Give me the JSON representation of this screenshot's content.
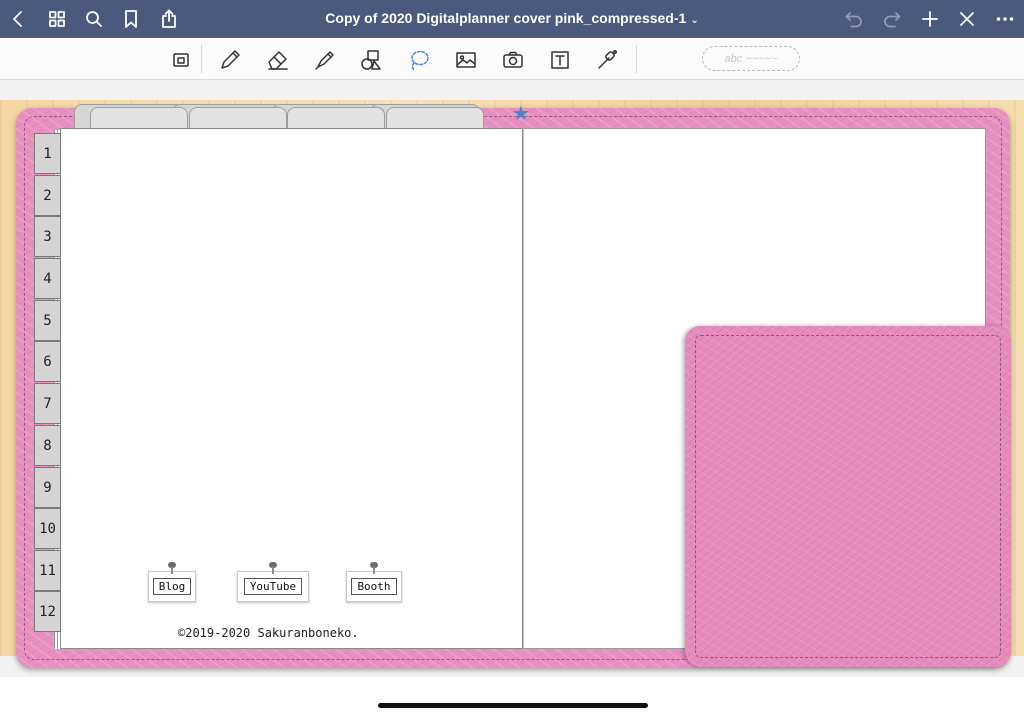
{
  "app": {
    "document_title": "Copy of 2020 Digitalplanner cover pink_compressed-1"
  },
  "navbar": {
    "left_icons": [
      "back-icon",
      "thumbnails-icon",
      "search-icon",
      "bookmark-icon",
      "share-icon"
    ],
    "right_icons": [
      "undo-icon",
      "redo-icon",
      "add-page-icon",
      "close-icon",
      "more-icon"
    ]
  },
  "toolbar": {
    "tools": [
      "zoom-window-icon",
      "pen-icon",
      "eraser-icon",
      "highlighter-icon",
      "shapes-icon",
      "lasso-icon",
      "image-icon",
      "camera-icon",
      "text-icon",
      "laser-pointer-icon"
    ],
    "text_recognition_placeholder": "abc ~~~~~"
  },
  "planner": {
    "month_tabs": [
      "1",
      "2",
      "3",
      "4",
      "5",
      "6",
      "7",
      "8",
      "9",
      "10",
      "11",
      "12"
    ],
    "links": [
      {
        "label": "Blog"
      },
      {
        "label": "YouTube"
      },
      {
        "label": "Booth"
      }
    ],
    "copyright": "©2019-2020 Sakuranboneko.",
    "star": "★"
  },
  "colors": {
    "nav_bg": "#4a5a7d",
    "cover_pink": "#e88fc1",
    "star_blue": "#4b82c8"
  }
}
